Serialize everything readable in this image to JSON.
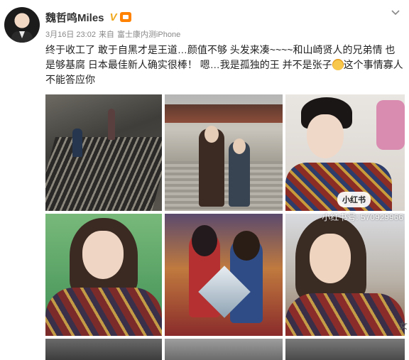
{
  "user": {
    "name": "魏哲鸣Miles",
    "verified_mark": "V",
    "avatar_icon": "avatar-icon",
    "level_icon": "weibo-level-icon"
  },
  "meta": {
    "timestamp": "3月16日 23:02",
    "source_prefix": "来自",
    "device": "富士康内测iPhone"
  },
  "post": {
    "text_part1": "终于收工了   敢于自黑才是王道…颜值不够 头发来凑~~~~和山崎贤人的兄弟情 也是够基腐  日本最佳新人确实很棒！   嗯…我是孤独的王  并不是张子",
    "text_part2": "这个事情寡人不能答应你",
    "emoji_icon": "doge-emoji-icon"
  },
  "watermark": {
    "badge": "小红书",
    "id_text": "小红书号: 570929966"
  },
  "edge_char": "女",
  "colors": {
    "accent_orange": "#ff8200",
    "verified_gold": "#f0a81c",
    "meta_gray": "#888888"
  }
}
